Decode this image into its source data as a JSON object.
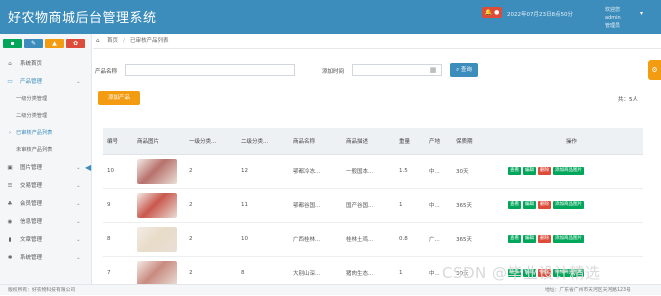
{
  "header": {
    "title": "好农物商城后台管理系统",
    "bell_badge": "🔔 ●",
    "datetime": "2022年07月23日8点50分",
    "user_line1": "欢迎您 admin",
    "user_line2": "管理员"
  },
  "toolbar_icons": [
    {
      "name": "chart-icon",
      "glyph": "▪",
      "color": "#00a65a"
    },
    {
      "name": "pencil-icon",
      "glyph": "✎",
      "color": "#3c8dbc"
    },
    {
      "name": "users-icon",
      "glyph": "▲",
      "color": "#f39c12"
    },
    {
      "name": "gears-icon",
      "glyph": "✿",
      "color": "#dd4b39"
    }
  ],
  "sidebar": {
    "home": "系统首页",
    "product_mgmt": "产品管理",
    "sub": [
      "一级分类管理",
      "二级分类管理",
      "已审核产品列表",
      "未审核产品列表"
    ],
    "groups": [
      "图片管理",
      "交易管理",
      "会员管理",
      "信息管理",
      "文章管理",
      "系统管理"
    ]
  },
  "breadcrumb": {
    "home": "首页",
    "current": "已审核产品列表"
  },
  "search": {
    "name_label": "产品名称",
    "date_label": "添加时间",
    "query_button": "查询"
  },
  "add_button": "添加产品",
  "total": "共：5人",
  "table": {
    "headers": [
      "编号",
      "商品图片",
      "一级分类...",
      "二级分类...",
      "商品名称",
      "商品描述",
      "重量",
      "产地",
      "保质期",
      "操作"
    ],
    "rows": [
      {
        "id": "10",
        "cat1": "2",
        "cat2": "12",
        "name": "鄂都冷冻...",
        "desc": "一般国本...",
        "weight": "1.5",
        "origin": "中...",
        "shelf": "30天",
        "img": "#b8716c"
      },
      {
        "id": "9",
        "cat1": "2",
        "cat2": "11",
        "name": "鄂都谷国...",
        "desc": "国产谷国...",
        "weight": "1",
        "origin": "中...",
        "shelf": "365天",
        "img": "#c9574d"
      },
      {
        "id": "8",
        "cat1": "2",
        "cat2": "10",
        "name": "广西桂林...",
        "desc": "桂林土鸡...",
        "weight": "0.8",
        "origin": "广...",
        "shelf": "365天",
        "img": "#e8dcc8"
      },
      {
        "id": "7",
        "cat1": "2",
        "cat2": "8",
        "name": "大别山深...",
        "desc": "猪肉生态...",
        "weight": "1",
        "origin": "中...",
        "shelf": "30天",
        "img": "#c98a80"
      }
    ],
    "ops": {
      "view": "查看",
      "edit": "编辑",
      "delete": "删除",
      "add_stock": "添加商品图片"
    }
  },
  "footer": {
    "left": "版权所有：好农物科技有限公司",
    "right": "地址：广东省广州市天河区天河路123号"
  },
  "watermark": "CSDN @毕业设计精选"
}
